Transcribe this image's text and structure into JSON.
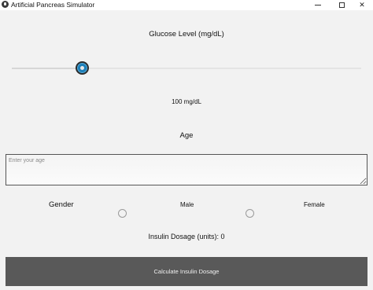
{
  "window": {
    "title": "Artificial Pancreas Simulator",
    "controls": {
      "minimize": "minimize-icon",
      "maximize": "maximize-icon",
      "close": "✕"
    }
  },
  "glucose": {
    "label": "Glucose Level (mg/dL)",
    "value_text": "100 mg/dL",
    "slider_fraction": 0.2
  },
  "age": {
    "label": "Age",
    "placeholder": "Enter your age",
    "value": ""
  },
  "gender": {
    "label": "Gender",
    "options": [
      "Male",
      "Female"
    ],
    "selected": null
  },
  "dosage": {
    "label": "Insulin Dosage (units): 0"
  },
  "actions": {
    "calculate_label": "Calculate Insulin Dosage"
  },
  "colors": {
    "accent": "#1d7fb8",
    "button_bg": "#595959",
    "window_bg": "#f2f2f2"
  }
}
